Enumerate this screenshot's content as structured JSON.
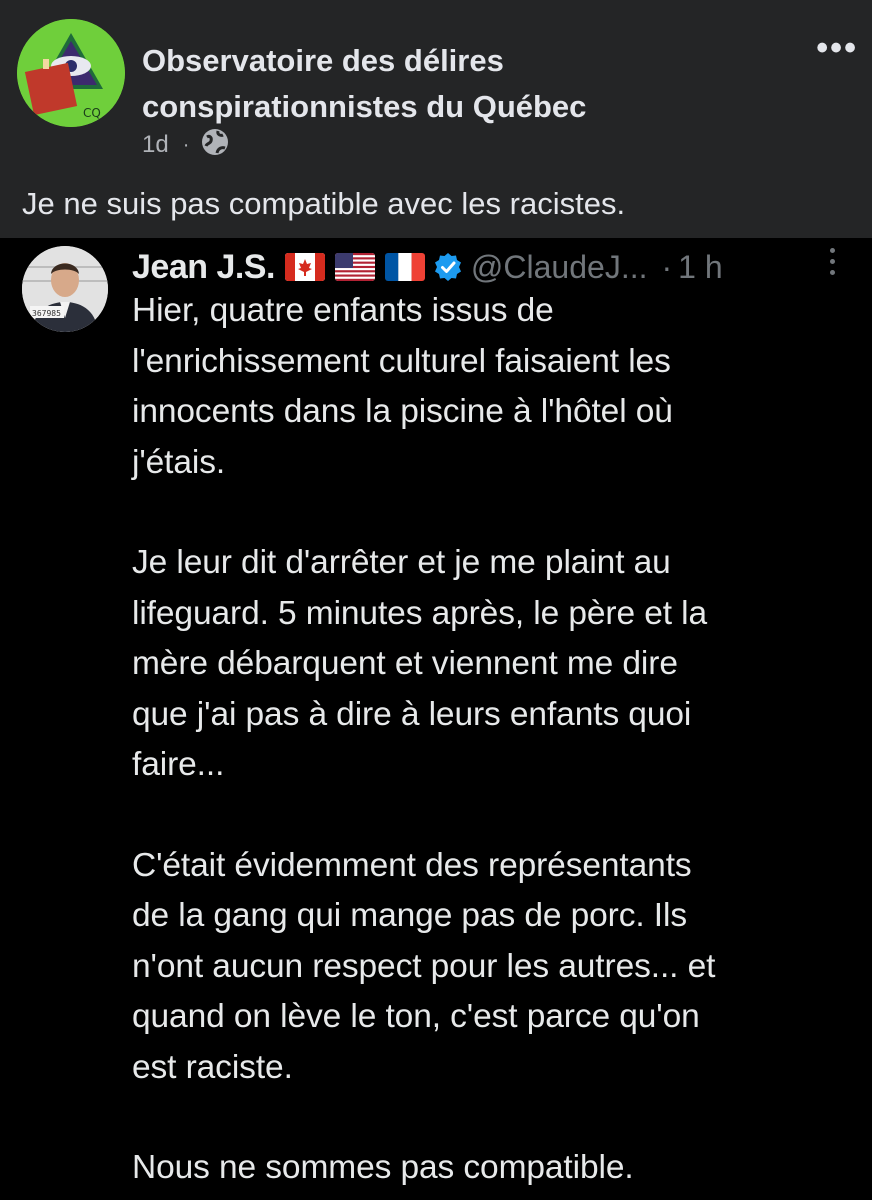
{
  "facebook_post": {
    "page_name": "Observatoire des délires\nconspirationnistes du Québec",
    "avatar_text": "CQ",
    "time": "1d",
    "separator": "·",
    "privacy_icon": "globe-icon",
    "more_icon": "more-horizontal-icon",
    "more_label": "•••",
    "caption": "Je ne suis pas compatible avec les racistes."
  },
  "tweet": {
    "avatar_label": "367985",
    "name": "Jean J.S.",
    "flags": [
      "canada-flag",
      "usa-flag",
      "france-flag"
    ],
    "verified_icon": "verified-badge-icon",
    "handle": "@ClaudeJ...",
    "separator": "·",
    "time": "1 h",
    "more_icon": "more-vertical-icon",
    "paragraphs": [
      "Hier, quatre enfants issus de\nl'enrichissement culturel faisaient les\ninnocents dans la piscine à l'hôtel où\nj'étais.",
      "Je leur dit d'arrêter et je me plaint au\nlifeguard. 5 minutes après, le père et la\nmère débarquent et viennent me dire\nque j'ai pas à dire à leurs enfants quoi\nfaire...",
      "C'était évidemment des représentants\nde la gang qui mange pas de porc. Ils\nn'ont aucun respect pour les autres... et\nquand on lève le ton, c'est parce qu'on\nest raciste.",
      "Nous ne sommes pas compatible."
    ]
  },
  "colors": {
    "fb_background": "#242526",
    "fb_text": "#e4e6eb",
    "fb_secondary": "#b0b3b8",
    "tweet_background": "#000000",
    "tweet_text": "#e7e9ea",
    "tweet_secondary": "#71767b",
    "verified_blue": "#1d9bf0",
    "avatar_green": "#6fcf3b"
  }
}
